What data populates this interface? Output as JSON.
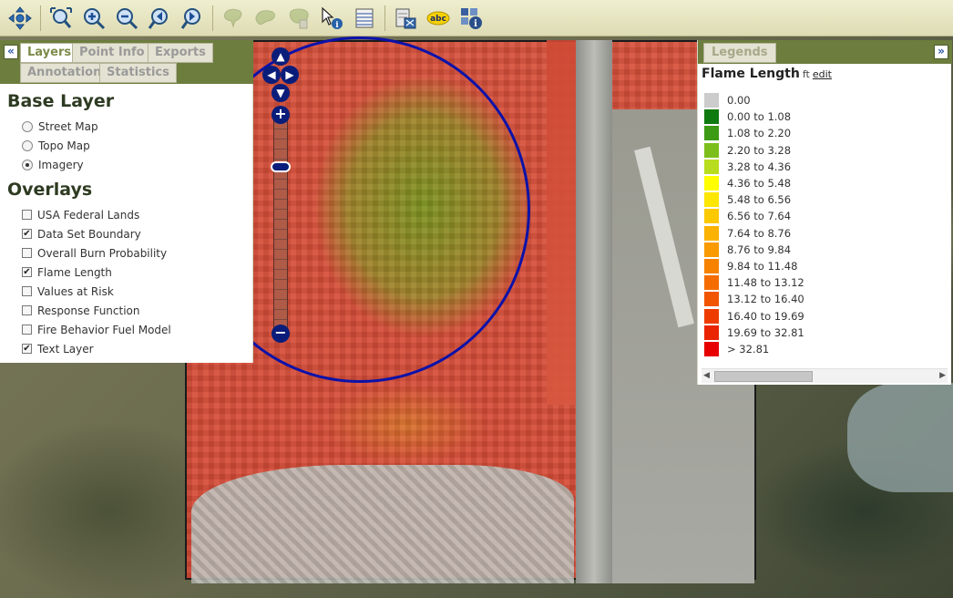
{
  "toolbar": {
    "buttons": [
      {
        "name": "pan-icon",
        "label": "Pan"
      },
      {
        "name": "zoom-full-extent-icon",
        "label": "Full Extent"
      },
      {
        "name": "zoom-in-icon",
        "label": "Zoom In"
      },
      {
        "name": "zoom-out-icon",
        "label": "Zoom Out"
      },
      {
        "name": "zoom-previous-icon",
        "label": "Previous Extent"
      },
      {
        "name": "zoom-next-icon",
        "label": "Next Extent"
      },
      {
        "name": "draw-polygon-icon",
        "label": "Draw Polygon"
      },
      {
        "name": "draw-freehand-icon",
        "label": "Draw Freehand"
      },
      {
        "name": "draw-area-icon",
        "label": "Draw Area"
      },
      {
        "name": "identify-icon",
        "label": "Identify"
      },
      {
        "name": "table-icon",
        "label": "Table"
      },
      {
        "name": "export-map-icon",
        "label": "Export Map"
      },
      {
        "name": "abc-label-icon",
        "label": "abc"
      },
      {
        "name": "info-grid-icon",
        "label": "Info"
      }
    ],
    "abc_text": "abc"
  },
  "left_panel": {
    "collapse_glyph": "«",
    "tabs": [
      "Layers",
      "Point Info",
      "Exports",
      "Annotation",
      "Statistics"
    ],
    "active_tab": "Layers",
    "base_layer_title": "Base Layer",
    "base_layers": [
      {
        "label": "Street Map",
        "selected": false
      },
      {
        "label": "Topo Map",
        "selected": false
      },
      {
        "label": "Imagery",
        "selected": true
      }
    ],
    "overlays_title": "Overlays",
    "overlays": [
      {
        "label": "USA Federal Lands",
        "checked": false
      },
      {
        "label": "Data Set Boundary",
        "checked": true
      },
      {
        "label": "Overall Burn Probability",
        "checked": false
      },
      {
        "label": "Flame Length",
        "checked": true
      },
      {
        "label": "Values at Risk",
        "checked": false
      },
      {
        "label": "Response Function",
        "checked": false
      },
      {
        "label": "Fire Behavior Fuel Model",
        "checked": false
      },
      {
        "label": "Text Layer",
        "checked": true
      }
    ]
  },
  "legend_panel": {
    "tab": "Legends",
    "expand_glyph": "»",
    "title": "Flame Length",
    "unit": "ft",
    "edit": "edit",
    "items": [
      {
        "label": "0.00",
        "color": "#cccccc"
      },
      {
        "label": "0.00 to 1.08",
        "color": "#0f7a0f"
      },
      {
        "label": "1.08 to 2.20",
        "color": "#3c9a14"
      },
      {
        "label": "2.20 to 3.28",
        "color": "#7cbf1c"
      },
      {
        "label": "3.28 to 4.36",
        "color": "#b8dc1e"
      },
      {
        "label": "4.36 to 5.48",
        "color": "#ffff00"
      },
      {
        "label": "5.48 to 6.56",
        "color": "#fde600"
      },
      {
        "label": "6.56 to 7.64",
        "color": "#fcc800"
      },
      {
        "label": "7.64 to 8.76",
        "color": "#fbb200"
      },
      {
        "label": "8.76 to 9.84",
        "color": "#f99a00"
      },
      {
        "label": "9.84 to 11.48",
        "color": "#f78200"
      },
      {
        "label": "11.48 to 13.12",
        "color": "#f56d00"
      },
      {
        "label": "13.12 to 16.40",
        "color": "#f25500"
      },
      {
        "label": "16.40 to 19.69",
        "color": "#ee3c00"
      },
      {
        "label": "19.69 to 32.81",
        "color": "#ea2400"
      },
      {
        "label": "> 32.81",
        "color": "#e60000"
      }
    ]
  },
  "map_controls": {
    "zoom_in": "+",
    "zoom_out": "−",
    "pan_up": "▲",
    "pan_down": "▼",
    "pan_left": "◀",
    "pan_right": "▶"
  }
}
